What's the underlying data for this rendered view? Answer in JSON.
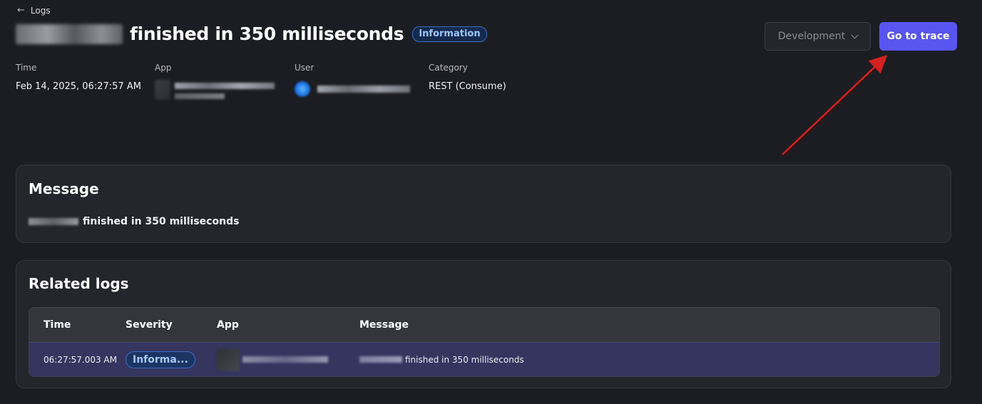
{
  "header": {
    "back_label": "Logs",
    "title": "finished in 350 milliseconds",
    "severity_badge": "Information"
  },
  "environment_select": {
    "value": "Development"
  },
  "trace_button": {
    "label": "Go to trace"
  },
  "meta": {
    "time_label": "Time",
    "time_value": "Feb 14, 2025, 06:27:57 AM",
    "app_label": "App",
    "user_label": "User",
    "category_label": "Category",
    "category_value": "REST (Consume)"
  },
  "message_panel": {
    "title": "Message",
    "body": "finished in 350 milliseconds"
  },
  "related_logs": {
    "title": "Related logs",
    "columns": [
      "Time",
      "Severity",
      "App",
      "Message"
    ],
    "rows": [
      {
        "time": "06:27:57.003 AM",
        "severity": "Informa...",
        "message": "finished in 350 milliseconds"
      }
    ]
  },
  "colors": {
    "background": "#1c1d22",
    "accent": "#5955f0",
    "annotation_arrow": "#d42020"
  },
  "icons": {
    "back": "arrow-left-icon",
    "dropdown": "chevron-down-icon"
  }
}
